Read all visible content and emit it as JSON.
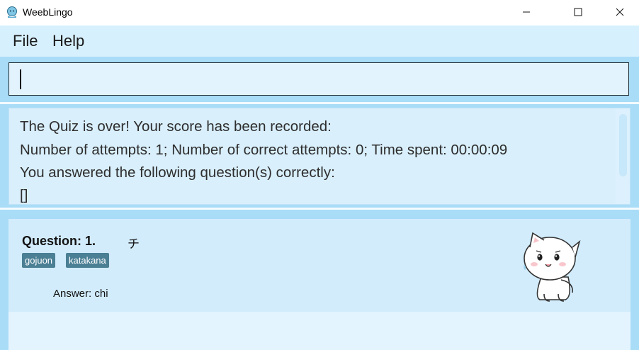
{
  "window": {
    "title": "WeebLingo",
    "icons": [
      "app-icon",
      "minimize-icon",
      "maximize-icon",
      "close-icon"
    ]
  },
  "menu": {
    "items": [
      "File",
      "Help"
    ]
  },
  "command_box": {
    "value": ""
  },
  "result_display": {
    "lines": [
      "The Quiz is over! Your score has been recorded:",
      "Number of attempts: 1; Number of correct attempts: 0; Time spent: 00:00:09",
      "You answered the following question(s) correctly:",
      "[]"
    ]
  },
  "flashcard": {
    "question_label": "Question: 1.",
    "question_char": "チ",
    "tags": [
      "gojuon",
      "katakana"
    ],
    "answer": "Answer: chi",
    "tag_color": "#4a7f94"
  },
  "colors": {
    "background": "#a9dcf7",
    "menubar": "#d7f0fd",
    "card": "#d2ecfc"
  }
}
